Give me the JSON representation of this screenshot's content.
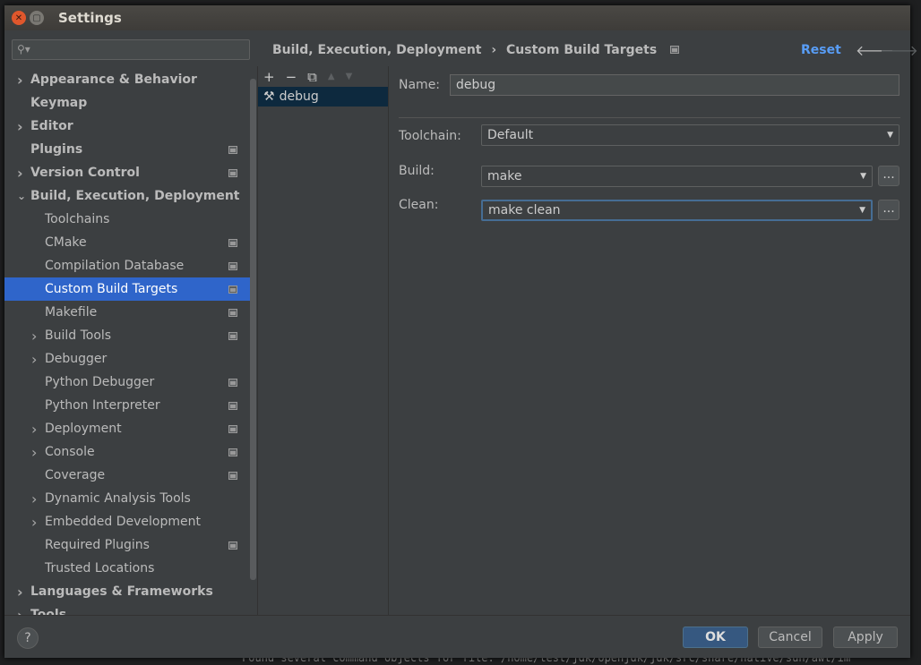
{
  "background": {
    "console_text": "Found several command objects for file: /home/test/jdk/openjdk/jdk/src/share/native/sun/awt/im"
  },
  "window": {
    "title": "Settings"
  },
  "search": {
    "placeholder": ""
  },
  "sidebar": {
    "items": [
      {
        "label": "Appearance & Behavior",
        "bold": true,
        "expandable": true,
        "level": 0
      },
      {
        "label": "Keymap",
        "bold": true,
        "level": 0
      },
      {
        "label": "Editor",
        "bold": true,
        "expandable": true,
        "level": 0
      },
      {
        "label": "Plugins",
        "bold": true,
        "level": 0,
        "project": true
      },
      {
        "label": "Version Control",
        "bold": true,
        "expandable": true,
        "level": 0,
        "project": true
      },
      {
        "label": "Build, Execution, Deployment",
        "bold": true,
        "expanded": true,
        "level": 0
      },
      {
        "label": "Toolchains",
        "level": 1
      },
      {
        "label": "CMake",
        "level": 1,
        "project": true
      },
      {
        "label": "Compilation Database",
        "level": 1,
        "project": true
      },
      {
        "label": "Custom Build Targets",
        "level": 1,
        "project": true,
        "selected": true
      },
      {
        "label": "Makefile",
        "level": 1,
        "project": true
      },
      {
        "label": "Build Tools",
        "level": 1,
        "expandable": true,
        "project": true
      },
      {
        "label": "Debugger",
        "level": 1,
        "expandable": true
      },
      {
        "label": "Python Debugger",
        "level": 1,
        "project": true
      },
      {
        "label": "Python Interpreter",
        "level": 1,
        "project": true
      },
      {
        "label": "Deployment",
        "level": 1,
        "expandable": true,
        "project": true
      },
      {
        "label": "Console",
        "level": 1,
        "expandable": true,
        "project": true
      },
      {
        "label": "Coverage",
        "level": 1,
        "project": true
      },
      {
        "label": "Dynamic Analysis Tools",
        "level": 1,
        "expandable": true
      },
      {
        "label": "Embedded Development",
        "level": 1,
        "expandable": true
      },
      {
        "label": "Required Plugins",
        "level": 1,
        "project": true
      },
      {
        "label": "Trusted Locations",
        "level": 1
      },
      {
        "label": "Languages & Frameworks",
        "bold": true,
        "expandable": true,
        "level": 0
      },
      {
        "label": "Tools",
        "bold": true,
        "expandable": true,
        "level": 0
      }
    ]
  },
  "breadcrumb": {
    "parent": "Build, Execution, Deployment",
    "sep": "›",
    "current": "Custom Build Targets"
  },
  "header": {
    "reset": "Reset",
    "back": "🡐",
    "forward": "🡒"
  },
  "targets": {
    "toolbar": {
      "add": "+",
      "remove": "−",
      "copy": "⧉",
      "up": "▲",
      "down": "▼"
    },
    "items": [
      {
        "label": "debug",
        "icon": "build-tools-icon"
      }
    ]
  },
  "form": {
    "name_label": "Name:",
    "name_value": "debug",
    "toolchain_label": "Toolchain:",
    "toolchain_value": "Default",
    "build_label": "Build:",
    "build_value": "make",
    "clean_label": "Clean:",
    "clean_value": "make clean",
    "browse": "..."
  },
  "footer": {
    "help": "?",
    "ok": "OK",
    "cancel": "Cancel",
    "apply": "Apply"
  },
  "colors": {
    "accent": "#589df6",
    "selection": "#2f65ca",
    "ok_button": "#365880"
  }
}
